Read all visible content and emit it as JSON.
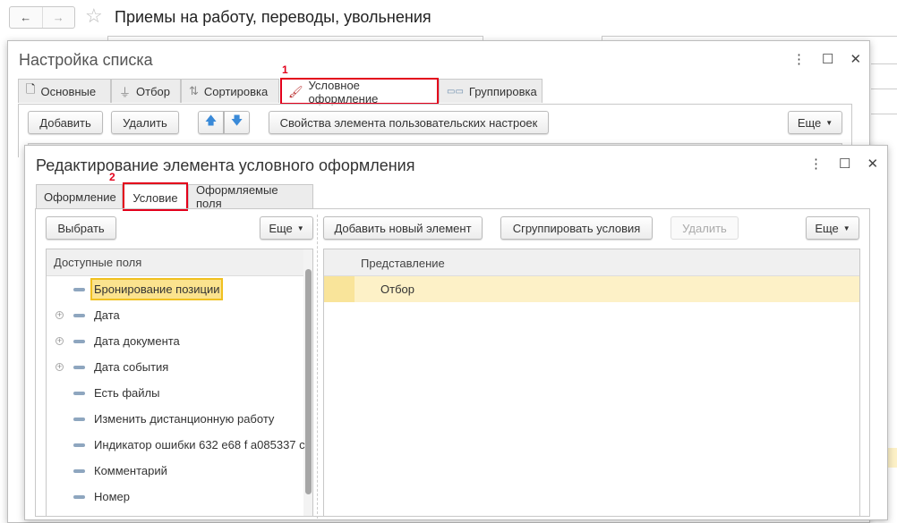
{
  "topbar": {
    "title": "Приемы на работу, переводы, увольнения",
    "back": "←",
    "forward": "→",
    "star": "☆"
  },
  "dialog1": {
    "title": "Настройка списка",
    "tabs": [
      {
        "label": "Основные"
      },
      {
        "label": "Отбор"
      },
      {
        "label": "Сортировка"
      },
      {
        "label": "Условное оформление"
      },
      {
        "label": "Группировка"
      }
    ],
    "marker": "1",
    "buttons": {
      "add": "Добавить",
      "delete": "Удалить",
      "up": "🡅",
      "down": "🡇",
      "properties": "Свойства элемента пользовательских настроек",
      "more": "Еще"
    }
  },
  "dialog2": {
    "title": "Редактирование элемента условного оформления",
    "tabs": [
      {
        "label": "Оформление"
      },
      {
        "label": "Условие"
      },
      {
        "label": "Оформляемые поля"
      }
    ],
    "marker": "2",
    "left": {
      "select": "Выбрать",
      "more": "Еще",
      "header": "Доступные поля",
      "fields": [
        {
          "label": "Бронирование позиции",
          "expandable": false,
          "selected": true
        },
        {
          "label": "Дата",
          "expandable": true
        },
        {
          "label": "Дата документа",
          "expandable": true
        },
        {
          "label": "Дата события",
          "expandable": true
        },
        {
          "label": "Есть файлы",
          "expandable": false
        },
        {
          "label": "Изменить дистанционную работу",
          "expandable": false
        },
        {
          "label": "Индикатор ошибки 632 e68 f a085337 c",
          "expandable": false
        },
        {
          "label": "Комментарий",
          "expandable": false
        },
        {
          "label": "Номер",
          "expandable": false
        }
      ]
    },
    "right": {
      "add": "Добавить новый элемент",
      "group": "Сгруппировать условия",
      "delete": "Удалить",
      "more": "Еще",
      "header": "Представление",
      "rows": [
        {
          "label": "Отбор"
        }
      ]
    }
  }
}
